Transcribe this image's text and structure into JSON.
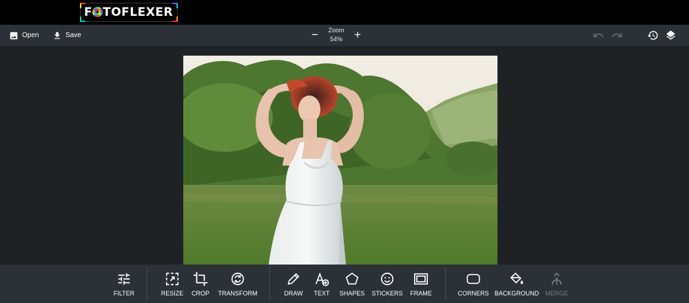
{
  "brand": {
    "logo_text": "FOTOFLEXER"
  },
  "topbar": {
    "open_label": "Open",
    "save_label": "Save",
    "zoom_label": "Zoom",
    "zoom_value": "54%",
    "zoom_out_symbol": "−",
    "zoom_in_symbol": "+"
  },
  "icons": {
    "open": "image-icon",
    "save": "download-icon",
    "undo": "undo-icon",
    "redo": "redo-icon",
    "history": "history-icon",
    "layers": "layers-icon"
  },
  "tools": {
    "filter": "FILTER",
    "resize": "RESIZE",
    "crop": "CROP",
    "transform": "TRANSFORM",
    "draw": "DRAW",
    "text": "TEXT",
    "shapes": "SHAPES",
    "stickers": "STICKERS",
    "frame": "FRAME",
    "corners": "CORNERS",
    "background": "BACKGROUND",
    "merge": "MERGE"
  },
  "colors": {
    "brand_bar": "#000000",
    "toolbar": "#2c3137",
    "workspace": "#1e2225",
    "disabled": "#7a7f85"
  }
}
